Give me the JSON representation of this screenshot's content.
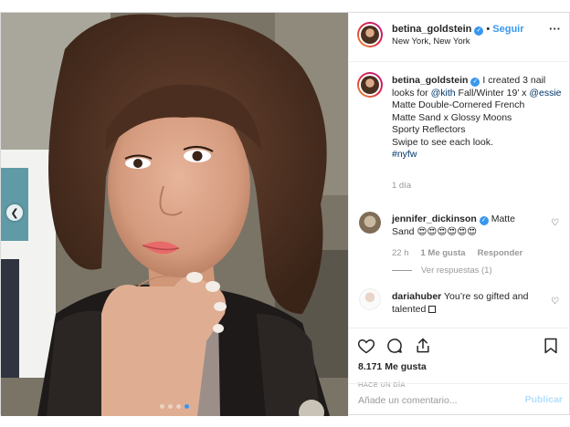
{
  "post": {
    "username": "betina_goldstein",
    "follow_label": "Seguir",
    "separator": "•",
    "location": "New York, New York",
    "more_icon": "ellipsis-icon",
    "caption": {
      "username": "betina_goldstein",
      "line1_pre": " I created 3 nail looks for ",
      "mention1": "@kith",
      "line1_mid": " Fall/Winter 19’ x ",
      "mention2": "@essie",
      "line2": "Matte Double-Cornered French",
      "line3": "Matte Sand x Glossy Moons",
      "line4": "Sporty Reflectors",
      "line5": "Swipe to see each look.",
      "hashtag": "#nyfw",
      "time": "1 día"
    },
    "comments": [
      {
        "username": "jennifer_dickinson",
        "text": " Matte Sand 😍😍😍😍😍😍",
        "time": "22 h",
        "likes": "1 Me gusta",
        "reply_label": "Responder",
        "view_replies": "Ver respuestas (1)"
      },
      {
        "username": "dariahuber",
        "text": " You’re so gifted and talented"
      }
    ],
    "likes": "8.171 Me gusta",
    "time_ago": "HACE UN DÍA",
    "comment_placeholder": "Añade un comentario...",
    "publish_label": "Publicar",
    "carousel": {
      "count": 4,
      "active_index": 3
    },
    "colors": {
      "accent": "#3897f0",
      "link": "#003569",
      "muted": "#999999"
    }
  }
}
